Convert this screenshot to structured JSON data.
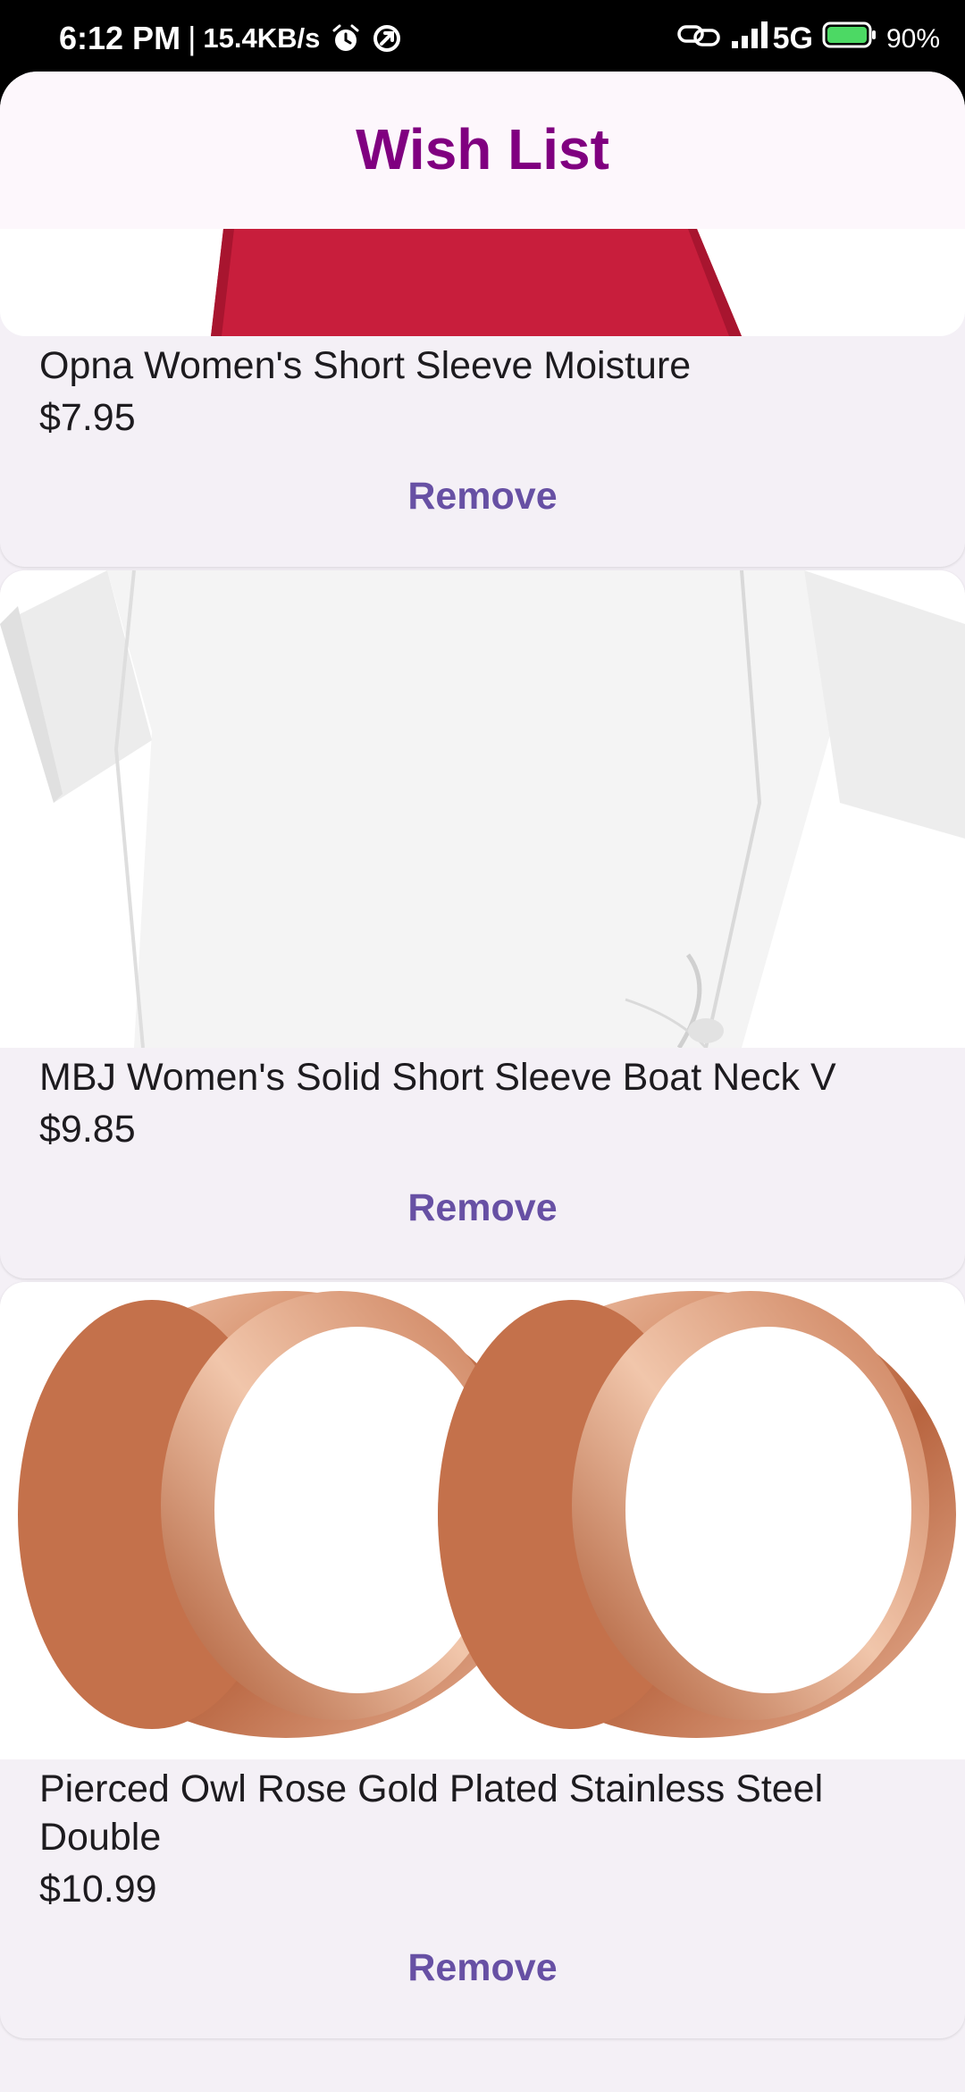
{
  "status_bar": {
    "time": "6:12 PM",
    "separator": "|",
    "speed": "15.4KB/s",
    "network": "5G",
    "battery": "90%",
    "icons": [
      "alarm-icon",
      "sync-icon",
      "link-icon",
      "signal-icon",
      "battery-icon"
    ]
  },
  "app": {
    "title": "Wish List",
    "accent_color": "#800080",
    "button_color": "#6750a4"
  },
  "items": [
    {
      "image": "red-shirt-image",
      "name": "Opna Women's Short Sleeve Moisture",
      "price": "$7.95",
      "remove_label": "Remove"
    },
    {
      "image": "white-shirt-image",
      "name": "MBJ Women's Solid Short Sleeve Boat Neck V",
      "price": "$9.85",
      "remove_label": "Remove"
    },
    {
      "image": "rose-gold-plugs-image",
      "name": "Pierced Owl Rose Gold Plated Stainless Steel Double",
      "price": "$10.99",
      "remove_label": "Remove"
    }
  ]
}
